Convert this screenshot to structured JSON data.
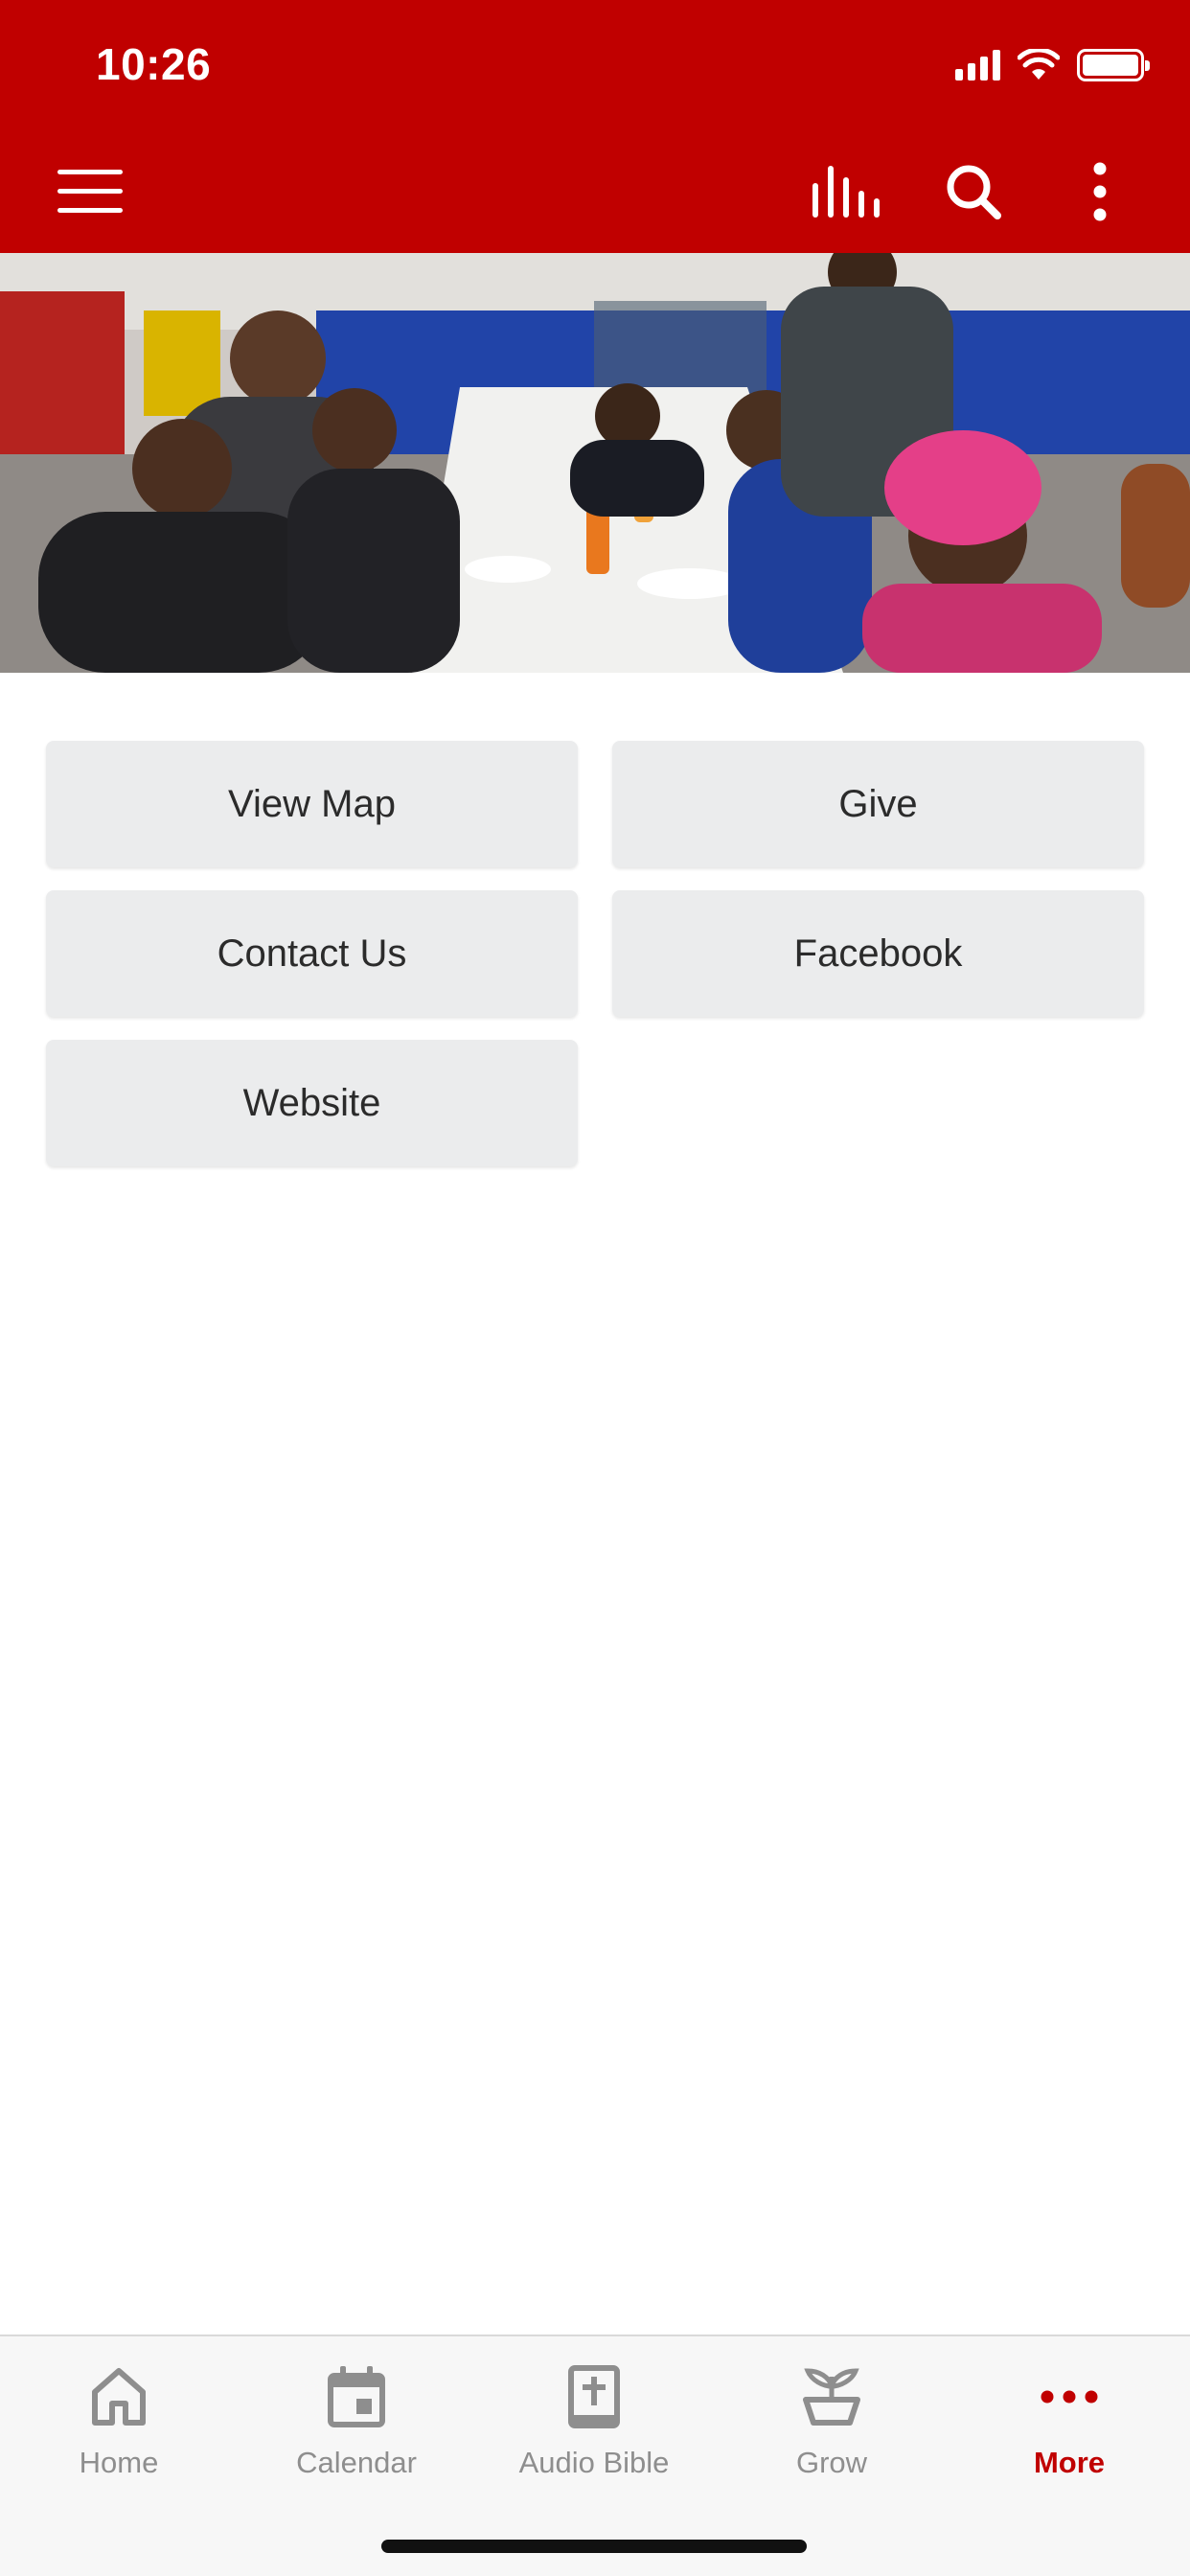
{
  "status_bar": {
    "time": "10:26"
  },
  "toolbar": {
    "menu_icon": "hamburger-icon",
    "audio_icon": "audio-bars-icon",
    "search_icon": "search-icon",
    "more_icon": "vertical-dots-icon"
  },
  "hero": {
    "description_icon": "photo"
  },
  "actions": [
    {
      "label": "View Map"
    },
    {
      "label": "Give"
    },
    {
      "label": "Contact Us"
    },
    {
      "label": "Facebook"
    },
    {
      "label": "Website"
    }
  ],
  "tabs": [
    {
      "label": "Home",
      "icon": "home-icon"
    },
    {
      "label": "Calendar",
      "icon": "calendar-icon"
    },
    {
      "label": "Audio Bible",
      "icon": "bible-icon"
    },
    {
      "label": "Grow",
      "icon": "plant-icon"
    },
    {
      "label": "More",
      "icon": "more-dots-icon",
      "active": true
    }
  ],
  "colors": {
    "brand": "#c00000",
    "tile_bg": "#ebeced",
    "tab_inactive": "#8e8e8e"
  }
}
